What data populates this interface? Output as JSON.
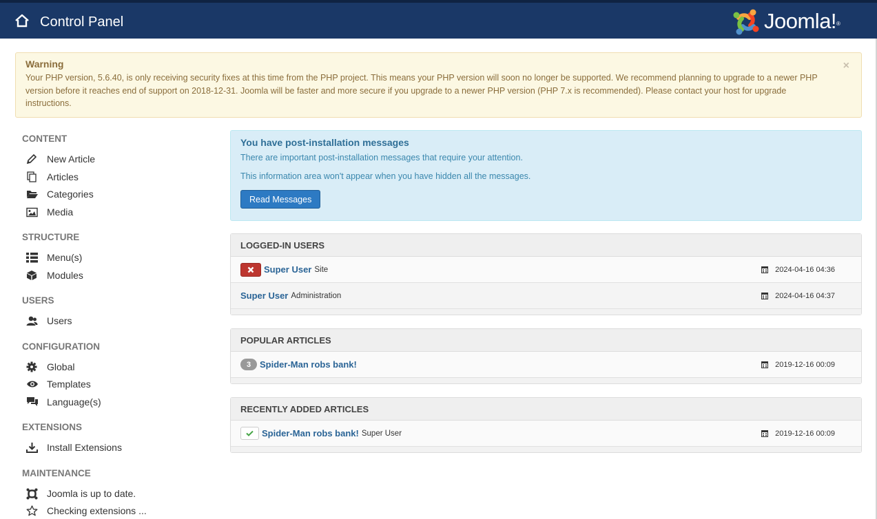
{
  "header": {
    "title": "Control Panel",
    "brand_logo": "joomla-logo",
    "brand_text": "Joomla!",
    "brand_mark": "®"
  },
  "warning": {
    "heading": "Warning",
    "text": "Your PHP version, 5.6.40, is only receiving security fixes at this time from the PHP project. This means your PHP version will soon no longer be supported. We recommend planning to upgrade to a newer PHP version before it reaches end of support on 2018-12-31. Joomla will be faster and more secure if you upgrade to a newer PHP version (PHP 7.x is recommended). Please contact your host for upgrade instructions.",
    "close": "×"
  },
  "sidebar": {
    "sections": [
      {
        "heading": "CONTENT",
        "items": [
          {
            "label": "New Article",
            "icon": "pencil-icon"
          },
          {
            "label": "Articles",
            "icon": "copy-icon"
          },
          {
            "label": "Categories",
            "icon": "folder-icon"
          },
          {
            "label": "Media",
            "icon": "image-icon"
          }
        ]
      },
      {
        "heading": "STRUCTURE",
        "items": [
          {
            "label": "Menu(s)",
            "icon": "list-icon"
          },
          {
            "label": "Modules",
            "icon": "cube-icon"
          }
        ]
      },
      {
        "heading": "USERS",
        "items": [
          {
            "label": "Users",
            "icon": "users-icon"
          }
        ]
      },
      {
        "heading": "CONFIGURATION",
        "items": [
          {
            "label": "Global",
            "icon": "gear-icon"
          },
          {
            "label": "Templates",
            "icon": "eye-icon"
          },
          {
            "label": "Language(s)",
            "icon": "comments-icon"
          }
        ]
      },
      {
        "heading": "EXTENSIONS",
        "items": [
          {
            "label": "Install Extensions",
            "icon": "download-icon"
          }
        ]
      },
      {
        "heading": "MAINTENANCE",
        "items": [
          {
            "label": "Joomla is up to date.",
            "icon": "joomla-icon"
          },
          {
            "label": "Checking extensions ...",
            "icon": "star-icon"
          }
        ]
      }
    ]
  },
  "postinstall": {
    "heading": "You have post-installation messages",
    "line1": "There are important post-installation messages that require your attention.",
    "line2": "This information area won't appear when you have hidden all the messages.",
    "button": "Read Messages"
  },
  "logged_in": {
    "heading": "LOGGED-IN USERS",
    "rows": [
      {
        "user": "Super User",
        "where": "Site",
        "date": "2024-04-16 04:36"
      },
      {
        "user": "Super User",
        "where": "Administration",
        "date": "2024-04-16 04:37"
      }
    ]
  },
  "popular": {
    "heading": "POPULAR ARTICLES",
    "rows": [
      {
        "hits": "3",
        "title": "Spider-Man robs bank!",
        "date": "2019-12-16 00:09"
      }
    ]
  },
  "recent": {
    "heading": "RECENTLY ADDED ARTICLES",
    "rows": [
      {
        "title": "Spider-Man robs bank!",
        "author": "Super User",
        "date": "2019-12-16 00:09"
      }
    ]
  },
  "colors": {
    "header_bg": "#1a3867",
    "warning_bg": "#fcf8e3",
    "info_bg": "#d9edf7",
    "primary": "#2d7ac3",
    "danger": "#bd362f",
    "link": "#2a6496"
  }
}
